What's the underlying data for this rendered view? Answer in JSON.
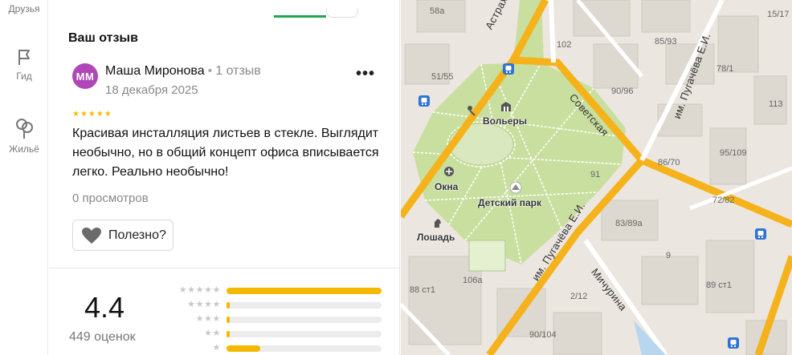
{
  "rail": {
    "friends_label": "Друзья",
    "guide_label": "Гид",
    "housing_label": "Жильё"
  },
  "review": {
    "section_title": "Ваш отзыв",
    "avatar_initials": "ММ",
    "author_name": "Маша Миронова",
    "author_reviews": "1 отзыв",
    "date": "18 декабря 2025",
    "more_label": "•••",
    "stars": "★★★★★",
    "rating": 5,
    "text": "Красивая инсталляция листьев в стекле. Выглядит необычно, но в общий концепт офиса вписывается легко. Реально необычно!",
    "views": "0 просмотров",
    "helpful_label": "Полезно?"
  },
  "rating_summary": {
    "value": "4.4",
    "count": "449 оценок",
    "distribution": [
      {
        "stars": "★★★★★",
        "fraction": 1.0
      },
      {
        "stars": "★★★★",
        "fraction": 0.02
      },
      {
        "stars": "★★★",
        "fraction": 0.02
      },
      {
        "stars": "★★",
        "fraction": 0.02
      },
      {
        "stars": "★",
        "fraction": 0.22
      }
    ]
  },
  "map": {
    "streets": {
      "astrakhanskaya": "Астраханская",
      "sovetskaya": "Советская",
      "pugacheva_top": "им. Пугачёва Е.И.",
      "pugacheva_bottom": "им. Пугачёва Е.И.",
      "michurina": "Мичурина"
    },
    "pois": {
      "volery": "Вольеры",
      "okna": "Окна",
      "detsky_park": "Детский парк",
      "loshad": "Лошадь"
    },
    "house_numbers": [
      "58а",
      "102",
      "51/55",
      "85/93",
      "15/17",
      "78/1",
      "113",
      "90/96",
      "95/109",
      "86/70",
      "91",
      "72/82",
      "83/89а",
      "9",
      "88 ст1",
      "106а",
      "2/12",
      "89 ст1",
      "90/104"
    ]
  },
  "colors": {
    "accent_green": "#1fa84f",
    "star_yellow": "#f5b800",
    "avatar": "#b046b8"
  }
}
